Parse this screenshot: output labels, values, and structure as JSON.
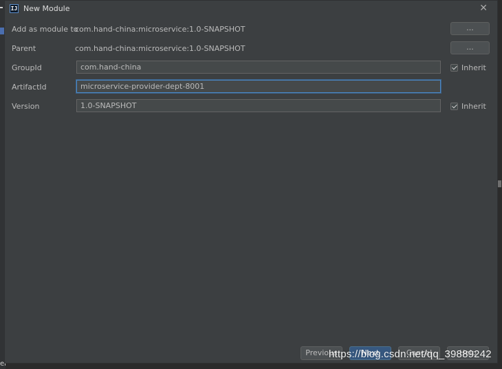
{
  "dialog": {
    "title": "New Module",
    "close_glyph": "✕",
    "app_icon": "intellij-icon",
    "app_icon_text": "IJ"
  },
  "form": {
    "add_as_module": {
      "label": "Add as module to",
      "value": "com.hand-china:microservice:1.0-SNAPSHOT",
      "button": "..."
    },
    "parent": {
      "label": "Parent",
      "value": "com.hand-china:microservice:1.0-SNAPSHOT",
      "button": "..."
    },
    "group_id": {
      "label": "GroupId",
      "value": "com.hand-china",
      "inherit_label": "Inherit",
      "inherit_checked": true
    },
    "artifact_id": {
      "label": "ArtifactId",
      "value": "microservice-provider-dept-8001"
    },
    "version": {
      "label": "Version",
      "value": "1.0-SNAPSHOT",
      "inherit_label": "Inherit",
      "inherit_checked": true
    }
  },
  "footer": {
    "previous": "Previous",
    "next": "Next",
    "cancel": "Cancel",
    "help": "Help"
  },
  "background": {
    "bottom_left_text": "er"
  },
  "watermark": "https://blog.csdn.net/qq_39889242",
  "colors": {
    "dialog_bg": "#3c3f41",
    "field_bg": "#45494a",
    "focus_border": "#4a88c7",
    "primary_button": "#365880"
  }
}
